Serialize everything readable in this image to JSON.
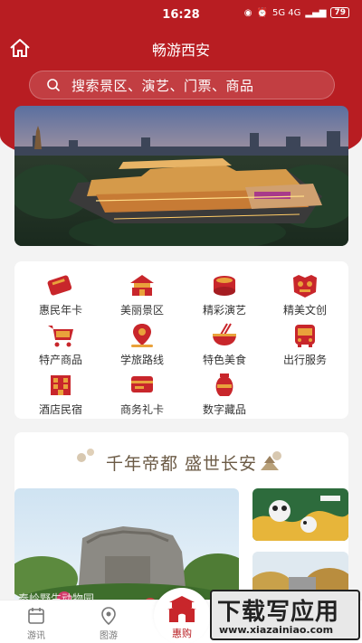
{
  "status": {
    "time": "16:28",
    "signal_text": "5G 4G",
    "battery": "79"
  },
  "header": {
    "title": "畅游西安"
  },
  "search": {
    "placeholder": "搜索景区、演艺、门票、商品"
  },
  "colors": {
    "brand": "#b81d22",
    "icon_red": "#c8262b",
    "icon_gold": "#e9a23b"
  },
  "menu": {
    "items": [
      {
        "label": "惠民年卡",
        "icon": "ticket-card-icon"
      },
      {
        "label": "美丽景区",
        "icon": "pavilion-icon"
      },
      {
        "label": "精彩演艺",
        "icon": "drum-icon"
      },
      {
        "label": "精美文创",
        "icon": "lion-mask-icon"
      },
      {
        "label": "特产商品",
        "icon": "shopping-cart-icon"
      },
      {
        "label": "学旅路线",
        "icon": "map-pin-icon"
      },
      {
        "label": "特色美食",
        "icon": "noodle-bowl-icon"
      },
      {
        "label": "出行服务",
        "icon": "bus-icon"
      },
      {
        "label": "酒店民宿",
        "icon": "hotel-icon"
      },
      {
        "label": "商务礼卡",
        "icon": "gift-card-icon"
      },
      {
        "label": "数字藏品",
        "icon": "vase-icon"
      }
    ]
  },
  "promo": {
    "slogan": "千年帝都 盛世长安",
    "main_card_label": "秦岭野生动物园"
  },
  "tabs": [
    {
      "label": "游讯",
      "icon": "news-icon"
    },
    {
      "label": "图游",
      "icon": "location-pin-icon"
    },
    {
      "label": "惠购",
      "icon": "gate-tower-icon"
    }
  ],
  "watermark": {
    "main": "下载写应用",
    "url": "www.xiazainiao.com"
  }
}
